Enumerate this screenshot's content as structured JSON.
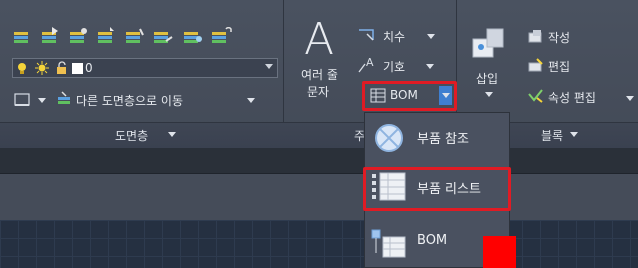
{
  "layers_panel": {
    "layer_value": "0",
    "move_to_layer_label": "다른 도면층으로 이동",
    "panel_title": "도면층"
  },
  "annotation_panel": {
    "multiline_text_label_line1": "여러 줄",
    "multiline_text_label_line2": "문자",
    "dimension_label": "치수",
    "symbol_label": "기호",
    "bom_label": "BOM",
    "panel_title_partial": "주"
  },
  "block_panel": {
    "insert_label": "삽입",
    "create_label": "작성",
    "edit_label": "편집",
    "attribute_edit_label": "속성 편집",
    "panel_title": "블록"
  },
  "bom_menu": {
    "items": [
      {
        "label": "부품 참조",
        "icon": "part-reference-icon"
      },
      {
        "label": "부품 리스트",
        "icon": "parts-list-icon"
      },
      {
        "label": "BOM",
        "icon": "bom-icon"
      }
    ]
  },
  "colors": {
    "highlight": "#e01b24",
    "ribbon_bg": "#4a5260",
    "canvas_bg": "#253041"
  }
}
